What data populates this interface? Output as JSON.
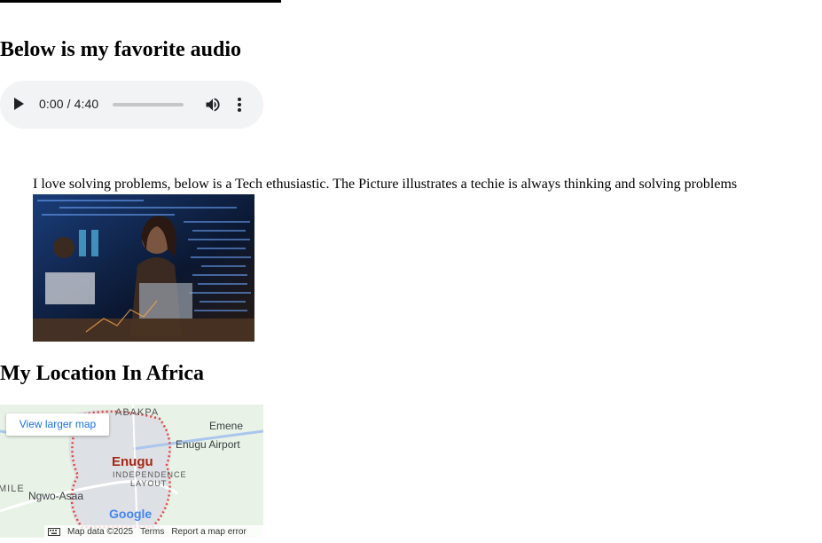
{
  "audio_section": {
    "heading": "Below is my favorite audio",
    "player": {
      "time": "0:00 / 4:40",
      "progress": 0
    }
  },
  "description": "I love solving problems, below is a Tech ethusiastic. The Picture illustrates a techie is always thinking and solving problems",
  "location": {
    "heading": "My Location In Africa",
    "map": {
      "larger_map_label": "View larger map",
      "places": {
        "abakpa": "ABAKPA",
        "emene": "Emene",
        "airport": "Enugu Airport",
        "city": "Enugu",
        "independence": "INDEPENDENCE",
        "layout": "LAYOUT",
        "mile": "MILE",
        "ngwo": "Ngwo-Asaa"
      },
      "logo": "Google",
      "footer": {
        "map_data": "Map data ©2025",
        "terms": "Terms",
        "report": "Report a map error"
      }
    }
  },
  "icons": {
    "play": "play-icon",
    "volume": "volume-icon",
    "more": "more-vert-icon",
    "keyboard": "keyboard-icon"
  },
  "colors": {
    "player_bg": "#f1f3f4",
    "link": "#1a73e8",
    "city_label": "#a52714",
    "boundary": "#e8453c"
  }
}
